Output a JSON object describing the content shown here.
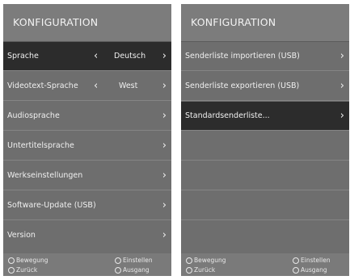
{
  "left": {
    "title": "KONFIGURATION",
    "rows": [
      {
        "label": "Sprache",
        "value": "Deutsch"
      },
      {
        "label": "Videotext-Sprache",
        "value": "West"
      },
      {
        "label": "Audiosprache"
      },
      {
        "label": "Untertitelsprache"
      },
      {
        "label": "Werkseinstellungen"
      },
      {
        "label": "Software-Update (USB)"
      },
      {
        "label": "Version"
      }
    ],
    "footer": {
      "move": "Bewegung",
      "set": "Einstellen",
      "back": "Zurück",
      "exit": "Ausgang"
    }
  },
  "right": {
    "title": "KONFIGURATION",
    "rows": [
      {
        "label": "Senderliste importieren (USB)"
      },
      {
        "label": "Senderliste exportieren (USB)"
      },
      {
        "label": "Standardsenderliste..."
      }
    ],
    "footer": {
      "move": "Bewegung",
      "set": "Einstellen",
      "back": "Zurück",
      "exit": "Ausgang"
    }
  },
  "selected": {
    "left_index": 0,
    "right_index": 2
  },
  "colors": {
    "panel": "#6e6e6e",
    "selected_row": "#2c2c2c",
    "text": "#f0f0f0"
  }
}
